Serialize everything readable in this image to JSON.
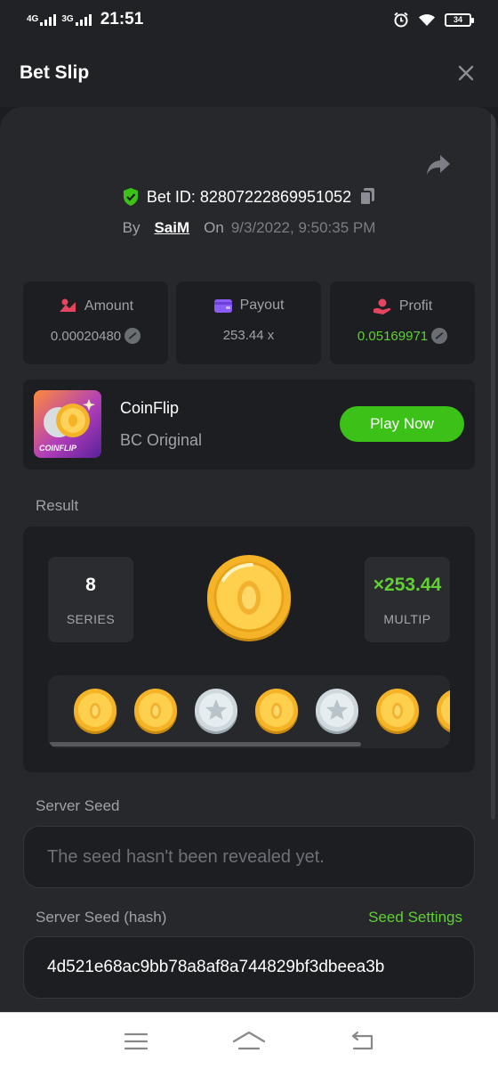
{
  "status_bar": {
    "network1": "4G",
    "network2": "3G",
    "time": "21:51",
    "battery": "34"
  },
  "header": {
    "title": "Bet Slip"
  },
  "bet": {
    "id_label": "Bet ID: 82807222869951052",
    "by_label": "By",
    "user": "SaiM",
    "on_label": "On",
    "date": "9/3/2022, 9:50:35 PM"
  },
  "stats": [
    {
      "label": "Amount",
      "value": "0.00020480",
      "color": "#9ea2a8"
    },
    {
      "label": "Payout",
      "value": "253.44 x",
      "color": "#9ea2a8"
    },
    {
      "label": "Profit",
      "value": "0.05169971",
      "color": "#5fd132"
    }
  ],
  "game": {
    "name": "CoinFlip",
    "subtitle": "BC Original",
    "thumb_label": "COINFLIP",
    "play_label": "Play Now"
  },
  "result": {
    "section_label": "Result",
    "series_value": "8",
    "series_label": "SERIES",
    "multiplier_value": "×253.44",
    "multiplier_label": "MULTIP",
    "coins": [
      "gold",
      "gold",
      "silver",
      "gold",
      "silver",
      "gold",
      "gold"
    ]
  },
  "server_seed": {
    "label": "Server Seed",
    "placeholder": "The seed hasn't been revealed yet."
  },
  "server_seed_hash": {
    "label": "Server Seed (hash)",
    "settings_link": "Seed Settings",
    "value": "4d521e68ac9bb78a8af8a744829bf3dbeea3b"
  },
  "colors": {
    "accent_green": "#3bc117",
    "profit_green": "#5fd132",
    "gold": "#f5b428",
    "silver": "#cfd8dc"
  }
}
